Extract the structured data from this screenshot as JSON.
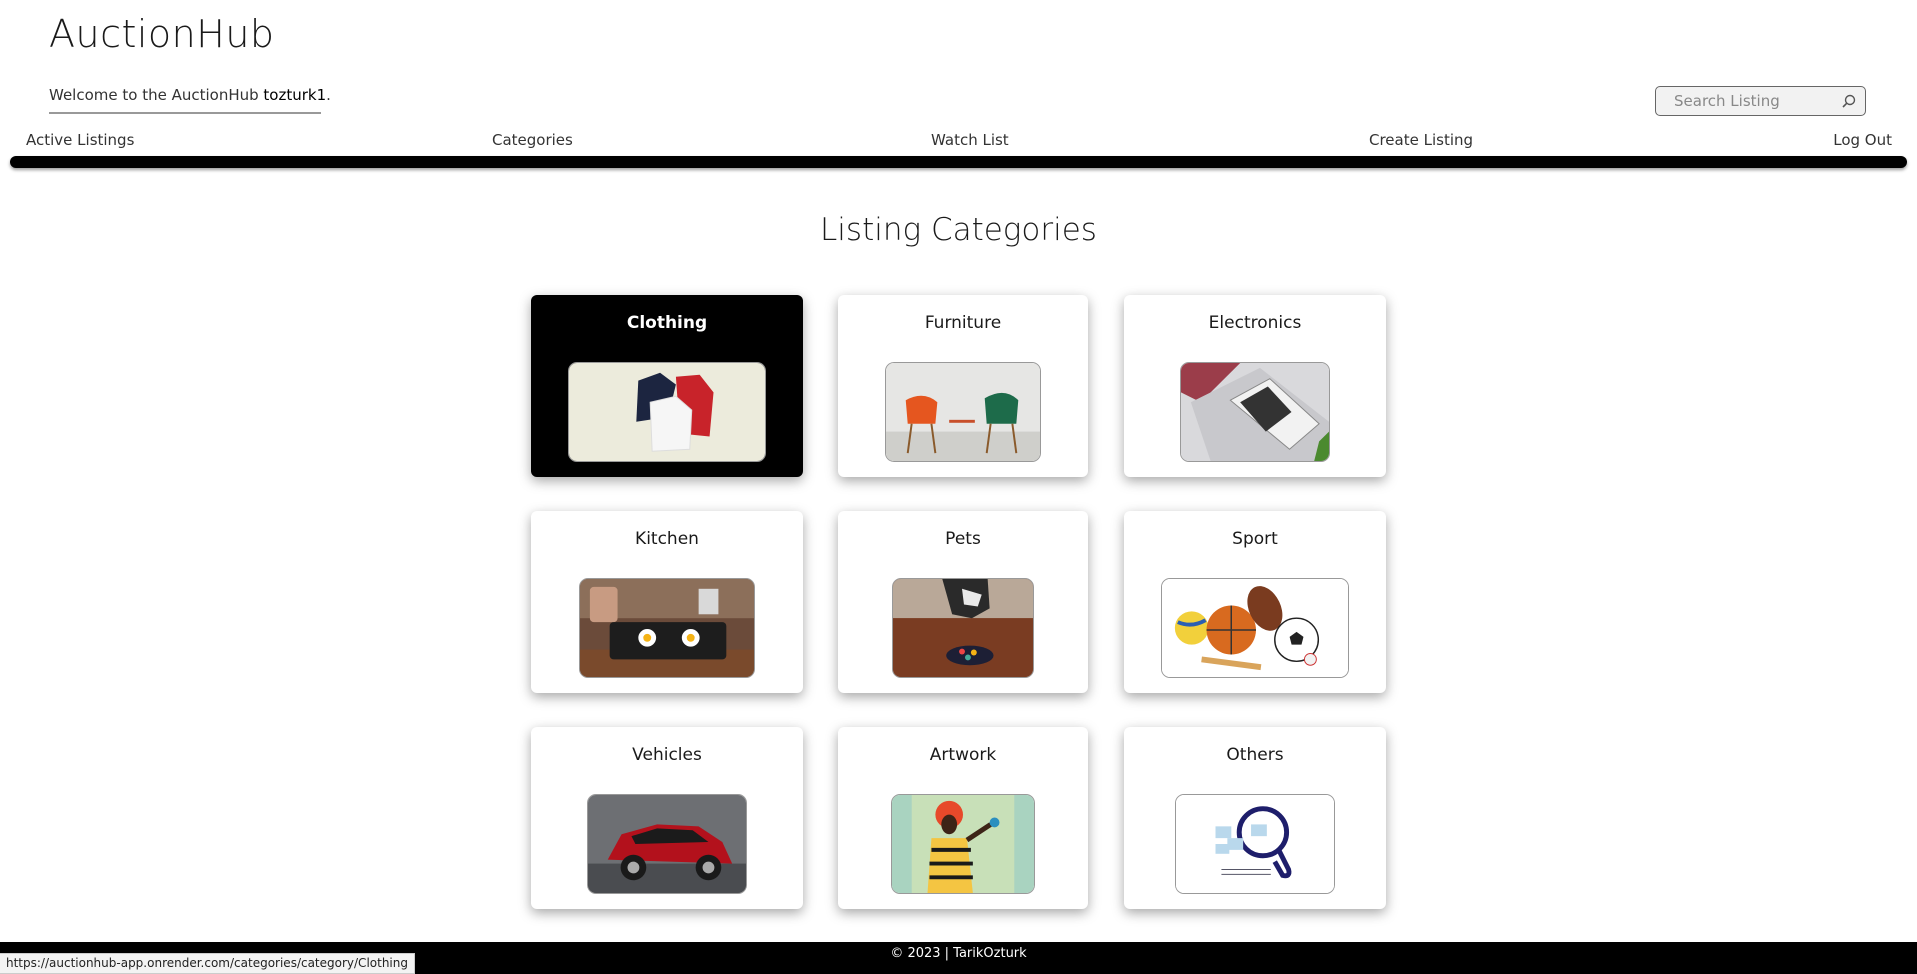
{
  "app": {
    "brand": "AuctionHub",
    "welcome_prefix": "Welcome to the AuctionHub ",
    "username": "tozturk1",
    "welcome_suffix": "."
  },
  "search": {
    "placeholder": "Search Listing",
    "icon": "search-icon"
  },
  "nav": {
    "items": [
      {
        "label": "Active Listings"
      },
      {
        "label": "Categories"
      },
      {
        "label": "Watch List"
      },
      {
        "label": "Create Listing"
      },
      {
        "label": "Log Out"
      }
    ]
  },
  "main": {
    "heading": "Listing Categories",
    "categories": [
      {
        "name": "Clothing",
        "image": "clothing-jackets-image",
        "active": true
      },
      {
        "name": "Furniture",
        "image": "furniture-chairs-image",
        "active": false
      },
      {
        "name": "Electronics",
        "image": "electronics-laptop-image",
        "active": false
      },
      {
        "name": "Kitchen",
        "image": "kitchen-griddle-image",
        "active": false
      },
      {
        "name": "Pets",
        "image": "pets-dog-image",
        "active": false
      },
      {
        "name": "Sport",
        "image": "sport-balls-image",
        "active": false
      },
      {
        "name": "Vehicles",
        "image": "vehicles-red-car-image",
        "active": false
      },
      {
        "name": "Artwork",
        "image": "artwork-painting-image",
        "active": false
      },
      {
        "name": "Others",
        "image": "others-magnifier-image",
        "active": false
      }
    ]
  },
  "footer": {
    "text": "© 2023 | TarikOzturk"
  },
  "status_bar": {
    "url": "https://auctionhub-app.onrender.com/categories/category/Clothing"
  },
  "colors": {
    "nav_bar": "#000000",
    "active_card": "#000000",
    "footer": "#000000"
  }
}
